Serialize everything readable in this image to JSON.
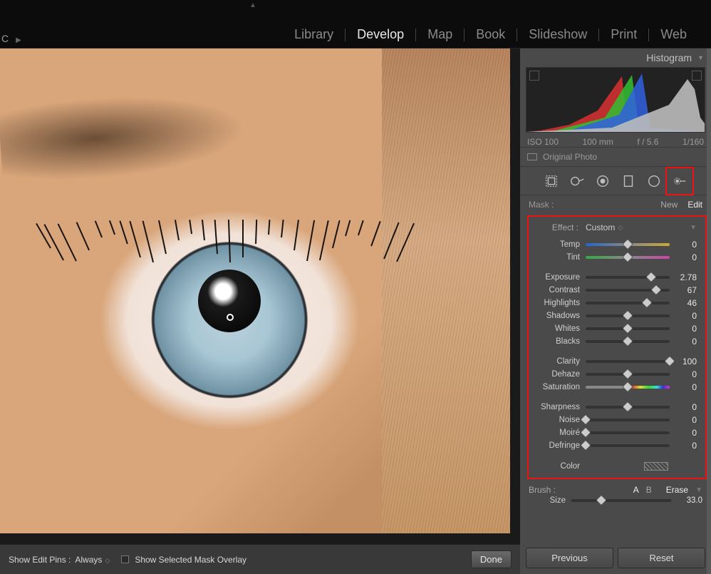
{
  "topbar": {
    "corner_label": "C",
    "collapse_top": "▲"
  },
  "modules": {
    "items": [
      "Library",
      "Develop",
      "Map",
      "Book",
      "Slideshow",
      "Print",
      "Web"
    ],
    "active_index": 1
  },
  "bottombar": {
    "pins_label": "Show Edit Pins :",
    "pins_value": "Always",
    "mask_overlay_label": "Show Selected Mask Overlay",
    "done_label": "Done"
  },
  "histogram": {
    "title": "Histogram",
    "exif": {
      "iso": "ISO 100",
      "focal": "100 mm",
      "aperture": "f / 5.6",
      "shutter": "1/160"
    },
    "original_photo_label": "Original Photo"
  },
  "toolstrip": {
    "tools": [
      "crop",
      "spot-removal",
      "red-eye",
      "graduated-filter",
      "radial-filter",
      "adjustment-brush"
    ],
    "active_index": 5
  },
  "mask": {
    "label": "Mask :",
    "new_label": "New",
    "edit_label": "Edit"
  },
  "effect": {
    "label": "Effect :",
    "preset": "Custom"
  },
  "sliders": {
    "group1": [
      {
        "name": "Temp",
        "value": 0,
        "pos": 50,
        "cls": "temp"
      },
      {
        "name": "Tint",
        "value": 0,
        "pos": 50,
        "cls": "tint"
      }
    ],
    "group2": [
      {
        "name": "Exposure",
        "value": "2.78",
        "pos": 78
      },
      {
        "name": "Contrast",
        "value": 67,
        "pos": 84
      },
      {
        "name": "Highlights",
        "value": 46,
        "pos": 73
      },
      {
        "name": "Shadows",
        "value": 0,
        "pos": 50
      },
      {
        "name": "Whites",
        "value": 0,
        "pos": 50
      },
      {
        "name": "Blacks",
        "value": 0,
        "pos": 50
      }
    ],
    "group3": [
      {
        "name": "Clarity",
        "value": 100,
        "pos": 100
      },
      {
        "name": "Dehaze",
        "value": 0,
        "pos": 50
      },
      {
        "name": "Saturation",
        "value": 0,
        "pos": 50,
        "cls": "sat"
      }
    ],
    "group4": [
      {
        "name": "Sharpness",
        "value": 0,
        "pos": 50
      },
      {
        "name": "Noise",
        "value": 0,
        "pos": 0
      },
      {
        "name": "Moiré",
        "value": 0,
        "pos": 0
      },
      {
        "name": "Defringe",
        "value": 0,
        "pos": 0
      }
    ],
    "color_label": "Color"
  },
  "brush": {
    "label": "Brush :",
    "a": "A",
    "b": "B",
    "erase": "Erase",
    "size_label": "Size",
    "size_value": "33.0",
    "size_pos": 30
  },
  "footer_buttons": {
    "previous": "Previous",
    "reset": "Reset"
  }
}
